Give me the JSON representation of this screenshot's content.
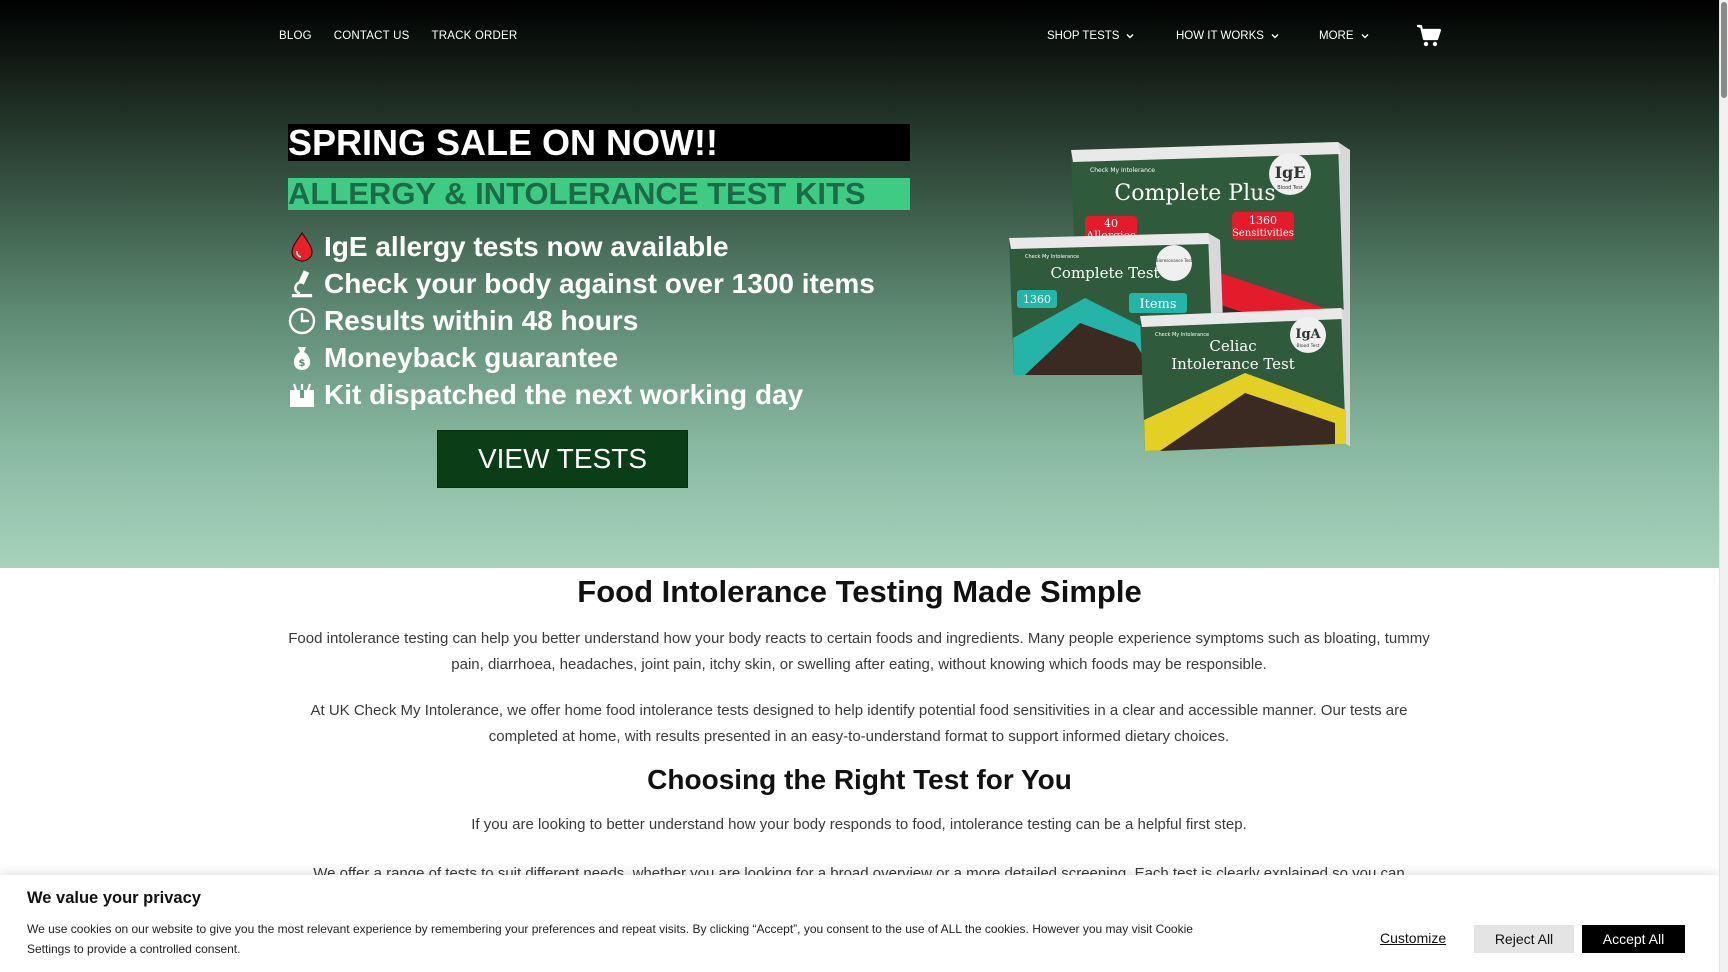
{
  "nav": {
    "left_links": [
      "BLOG",
      "CONTACT US",
      "TRACK ORDER"
    ],
    "shop_tests": "SHOP TESTS",
    "how_it_works": "HOW IT WORKS",
    "more": "MORE",
    "cart_icon": "cart-icon"
  },
  "hero": {
    "sale_banner": "SPRING SALE ON NOW!!",
    "kits_banner": "ALLERGY & INTOLERANCE TEST KITS",
    "features": [
      {
        "icon": "blood-drop-icon",
        "text": "IgE allergy tests now available"
      },
      {
        "icon": "microscope-icon",
        "text": "Check your body against over 1300 items"
      },
      {
        "icon": "clock-icon",
        "text": "Results within 48 hours"
      },
      {
        "icon": "money-bag-icon",
        "text": "Moneyback guarantee"
      },
      {
        "icon": "package-icon",
        "text": "Kit dispatched the next working day"
      }
    ],
    "cta": "VIEW TESTS",
    "product_image": {
      "brand": "Check My Intolerance",
      "box1": {
        "title": "Complete Plus",
        "badge": "IgE",
        "badge_sub": "Blood Test",
        "tag1": "40",
        "tag1_sub": "Allergies",
        "tag2": "1360",
        "tag2_sub": "Sensitivities"
      },
      "box2": {
        "title": "Complete Test",
        "badge": "Bioresonance Test",
        "tag1": "1360",
        "tag2": "Items"
      },
      "box3": {
        "title_line1": "Celiac",
        "title_line2": "Intolerance Test",
        "badge": "IgA",
        "badge_sub": "Blood Test"
      },
      "colors": {
        "box_green": "#2f5a3c",
        "red": "#e31b2b",
        "teal": "#24b5a8",
        "yellow": "#e4cf25"
      }
    }
  },
  "content": {
    "h1": "Food Intolerance Testing Made Simple",
    "p1": "Food intolerance testing can help you better understand how your body reacts to certain foods and ingredients. Many people experience symptoms such as bloating, tummy pain, diarrhoea, headaches, joint pain, itchy skin, or swelling after eating, without knowing which foods may be responsible.",
    "p2": "At UK Check My Intolerance, we offer home food intolerance tests designed to help identify potential food sensitivities in a clear and accessible manner. Our tests are completed at home, with results presented in an easy-to-understand format to support informed dietary choices.",
    "h2": "Choosing the Right Test for You",
    "p3": "If you are looking to better understand how your body responds to food, intolerance testing can be a helpful first step.",
    "p4": "We offer a range of tests to suit different needs, whether you are looking for a broad overview or a more detailed screening. Each test is clearly explained so you can"
  },
  "cookie": {
    "title": "We value your privacy",
    "text": "We use cookies on our website to give you the most relevant experience by remembering your preferences and repeat visits. By clicking “Accept”, you consent to the use of ALL the cookies. However you may visit Cookie Settings to provide a controlled consent.",
    "customize": "Customize",
    "reject": "Reject All",
    "accept": "Accept All"
  }
}
